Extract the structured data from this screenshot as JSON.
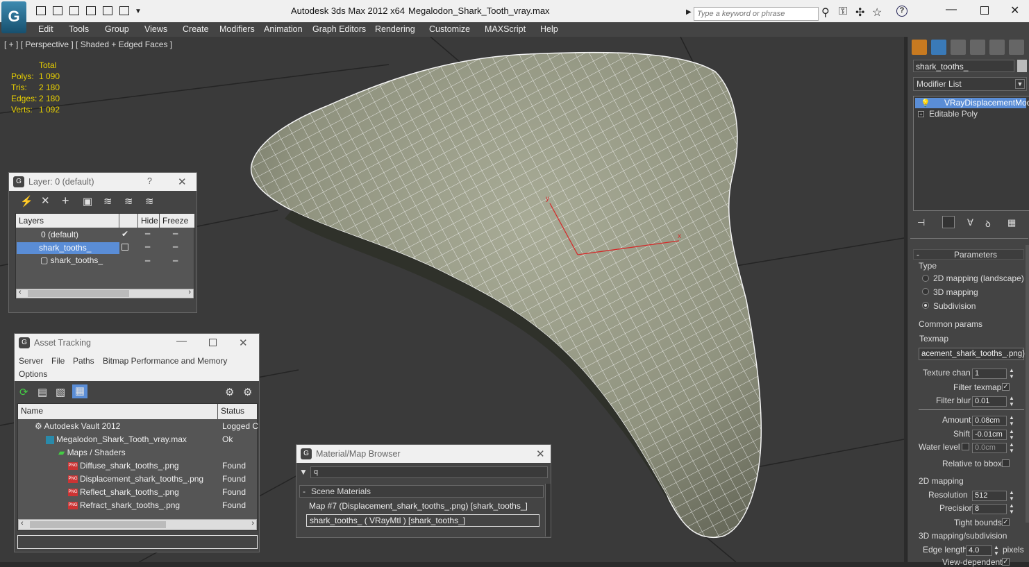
{
  "titlebar": {
    "app_title": "Autodesk 3ds Max  2012 x64",
    "file_name": "Megalodon_Shark_Tooth_vray.max",
    "search_placeholder": "Type a keyword or phrase",
    "help_label": "?"
  },
  "menu": [
    "Edit",
    "Tools",
    "Group",
    "Views",
    "Create",
    "Modifiers",
    "Animation",
    "Graph Editors",
    "Rendering",
    "Customize",
    "MAXScript",
    "Help"
  ],
  "viewport": {
    "label": "[ + ] [ Perspective ] [ Shaded + Edged Faces ]",
    "stats_header": "Total",
    "stats": [
      {
        "label": "Polys:",
        "value": "1 090"
      },
      {
        "label": "Tris:",
        "value": "2 180"
      },
      {
        "label": "Edges:",
        "value": "2 180"
      },
      {
        "label": "Verts:",
        "value": "1 092"
      }
    ],
    "axis_x": "x",
    "axis_y": "y"
  },
  "command_panel": {
    "object_name": "shark_tooths_",
    "modifier_list": "Modifier List",
    "stack": [
      "VRayDisplacementMod",
      "Editable Poly"
    ],
    "rollout_title": "Parameters",
    "type_label": "Type",
    "type_options": [
      "2D mapping (landscape)",
      "3D mapping",
      "Subdivision"
    ],
    "type_selected": "Subdivision",
    "common_label": "Common params",
    "texmap_label": "Texmap",
    "texmap_value": "acement_shark_tooths_.png)",
    "texture_chan_label": "Texture chan",
    "texture_chan_value": "1",
    "filter_texmap_label": "Filter texmap",
    "filter_blur_label": "Filter blur",
    "filter_blur_value": "0.01",
    "amount_label": "Amount",
    "amount_value": "0.08cm",
    "shift_label": "Shift",
    "shift_value": "-0.01cm",
    "water_label": "Water level",
    "water_value": "0.0cm",
    "relative_label": "Relative to bbox",
    "mapping2d_label": "2D mapping",
    "resolution_label": "Resolution",
    "resolution_value": "512",
    "precision_label": "Precision",
    "precision_value": "8",
    "tight_label": "Tight bounds",
    "mapping3d_label": "3D mapping/subdivision",
    "edge_label": "Edge length",
    "edge_value": "4.0",
    "edge_unit": "pixels",
    "view_dep_label": "View-dependent"
  },
  "layer_window": {
    "title": "Layer: 0 (default)",
    "help": "?",
    "columns": [
      "Layers",
      "Hide",
      "Freeze"
    ],
    "rows": [
      "0 (default)",
      "shark_tooths_",
      "shark_tooths_"
    ]
  },
  "asset_window": {
    "title": "Asset Tracking",
    "menu": [
      "Server",
      "File",
      "Paths",
      "Bitmap Performance and Memory",
      "Options"
    ],
    "columns": [
      "Name",
      "Status"
    ],
    "png_badge": "PNG",
    "rows": [
      {
        "name": "Autodesk Vault 2012",
        "status": "Logged C",
        "indent": 0
      },
      {
        "name": "Megalodon_Shark_Tooth_vray.max",
        "status": "Ok",
        "indent": 1
      },
      {
        "name": "Maps / Shaders",
        "status": "",
        "indent": 2
      },
      {
        "name": "Diffuse_shark_tooths_.png",
        "status": "Found",
        "indent": 3
      },
      {
        "name": "Displacement_shark_tooths_.png",
        "status": "Found",
        "indent": 3
      },
      {
        "name": "Reflect_shark_tooths_.png",
        "status": "Found",
        "indent": 3
      },
      {
        "name": "Refract_shark_tooths_.png",
        "status": "Found",
        "indent": 3
      }
    ]
  },
  "material_window": {
    "title": "Material/Map Browser",
    "search_value": "q",
    "group": "Scene Materials",
    "items": [
      "Map #7 (Displacement_shark_tooths_.png) [shark_tooths_]",
      "shark_tooths_ ( VRayMtl ) [shark_tooths_]"
    ]
  },
  "colors": {
    "accent": "#5a8dd6",
    "stats": "#e8d000",
    "mesh": "#9a9d88"
  }
}
